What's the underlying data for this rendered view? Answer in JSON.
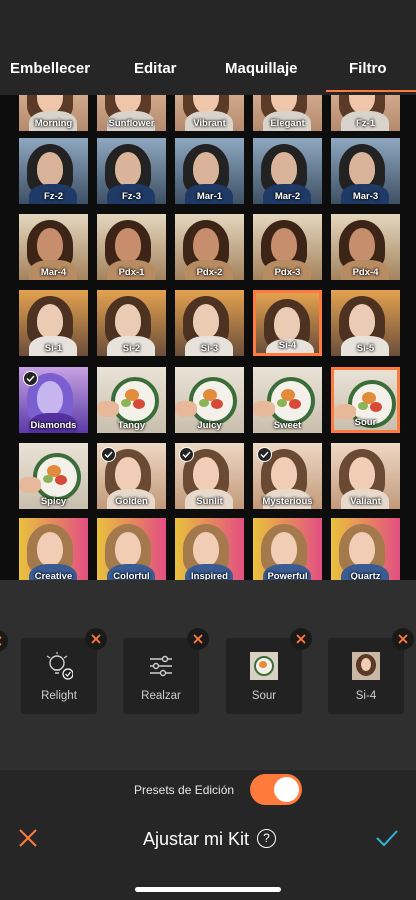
{
  "tabs": [
    {
      "label": "Embellecer",
      "active": false
    },
    {
      "label": "Editar",
      "active": false
    },
    {
      "label": "Maquillaje",
      "active": false
    },
    {
      "label": "Filtro",
      "active": true
    }
  ],
  "accent_color": "#ff7a3d",
  "confirm_color": "#35b5d6",
  "filters": [
    [
      "Morning",
      "Sunflower",
      "Vibrant",
      "Elegant",
      "Fz-1"
    ],
    [
      "Fz-2",
      "Fz-3",
      "Mar-1",
      "Mar-2",
      "Mar-3"
    ],
    [
      "Mar-4",
      "Pdx-1",
      "Pdx-2",
      "Pdx-3",
      "Pdx-4"
    ],
    [
      "Si-1",
      "Si-2",
      "Si-3",
      "Si-4",
      "Si-5"
    ],
    [
      "Diamonds",
      "Tangy",
      "Juicy",
      "Sweet",
      "Sour"
    ],
    [
      "Spicy",
      "Golden",
      "Sunlit",
      "Mysterious",
      "Valiant"
    ],
    [
      "Creative",
      "Colorful",
      "Inspired",
      "Powerful",
      "Quartz"
    ]
  ],
  "selected_filters": [
    "Si-4",
    "Sour"
  ],
  "checked_filters": [
    "Diamonds",
    "Golden",
    "Sunlit",
    "Mysterious"
  ],
  "kit_items": [
    {
      "label": "Relight",
      "icon": "relight-icon"
    },
    {
      "label": "Realzar",
      "icon": "sliders-icon"
    },
    {
      "label": "Sour",
      "icon": "sour-thumbnail"
    },
    {
      "label": "Si-4",
      "icon": "si-4-thumbnail"
    }
  ],
  "presets": {
    "label": "Presets de Edición",
    "enabled": true
  },
  "footer": {
    "title": "Ajustar mi Kit",
    "help": "?"
  }
}
